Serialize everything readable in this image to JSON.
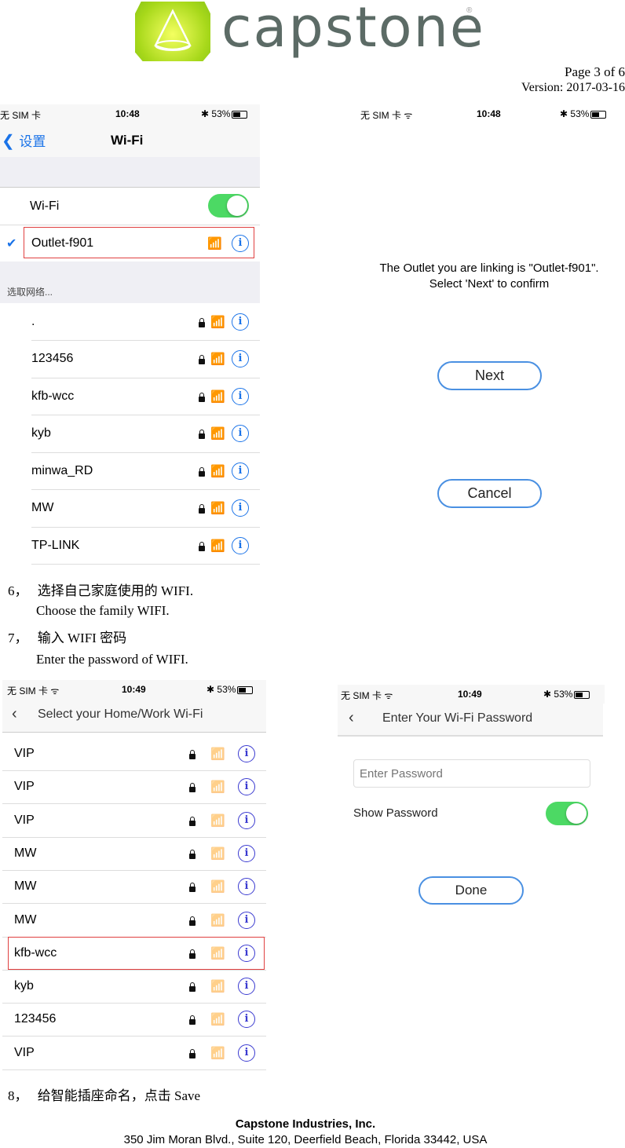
{
  "header": {
    "logo_text": "capstone",
    "page": "Page  3  of  6",
    "version": "Version:  2017-03-16"
  },
  "shot1": {
    "carrier": "无 SIM 卡",
    "time": "10:48",
    "battery": "53%",
    "back": "设置",
    "title": "Wi-Fi",
    "wifi_label": "Wi-Fi",
    "wifi_on": true,
    "connected": "Outlet-f901",
    "section": "选取网络...",
    "networks": [
      ".",
      "123456",
      "kfb-wcc",
      "kyb",
      "minwa_RD",
      "MW",
      "TP-LINK"
    ]
  },
  "shot2": {
    "carrier": "无 SIM 卡",
    "time": "10:48",
    "battery": "53%",
    "message_line1": "The Outlet you are linking is \"Outlet-f901\".",
    "message_line2": "Select 'Next' to confirm",
    "next": "Next",
    "cancel": "Cancel"
  },
  "steps": {
    "s6_num": "6，",
    "s6_cn": "选择自己家庭使用的 WIFI.",
    "s6_en": "Choose the family WIFI.",
    "s7_num": "7，",
    "s7_cn": "输入 WIFI 密码",
    "s7_en": "Enter the password of WIFI.",
    "s8_num": "8，",
    "s8_cn": "给智能插座命名，点击 Save"
  },
  "shot3": {
    "carrier": "无 SIM 卡",
    "time": "10:49",
    "battery": "53%",
    "title": "Select your Home/Work Wi-Fi",
    "networks": [
      "VIP",
      "VIP",
      "VIP",
      "MW",
      "MW",
      "MW",
      "kfb-wcc",
      "kyb",
      "123456",
      "VIP"
    ],
    "selected_index": 6
  },
  "shot4": {
    "carrier": "无 SIM 卡",
    "time": "10:49",
    "battery": "53%",
    "title": "Enter Your Wi-Fi Password",
    "password_placeholder": "Enter Password",
    "password_value": "",
    "show_password": "Show Password",
    "show_password_on": true,
    "done": "Done"
  },
  "footer": {
    "company": "Capstone Industries, Inc.",
    "address": "350 Jim Moran Blvd., Suite 120, Deerfield Beach, Florida 33442, USA"
  },
  "colors": {
    "ios_blue": "#1a73e8",
    "toggle_green": "#4cd964",
    "highlight_red": "#e04040",
    "button_border": "#4a90e2"
  }
}
